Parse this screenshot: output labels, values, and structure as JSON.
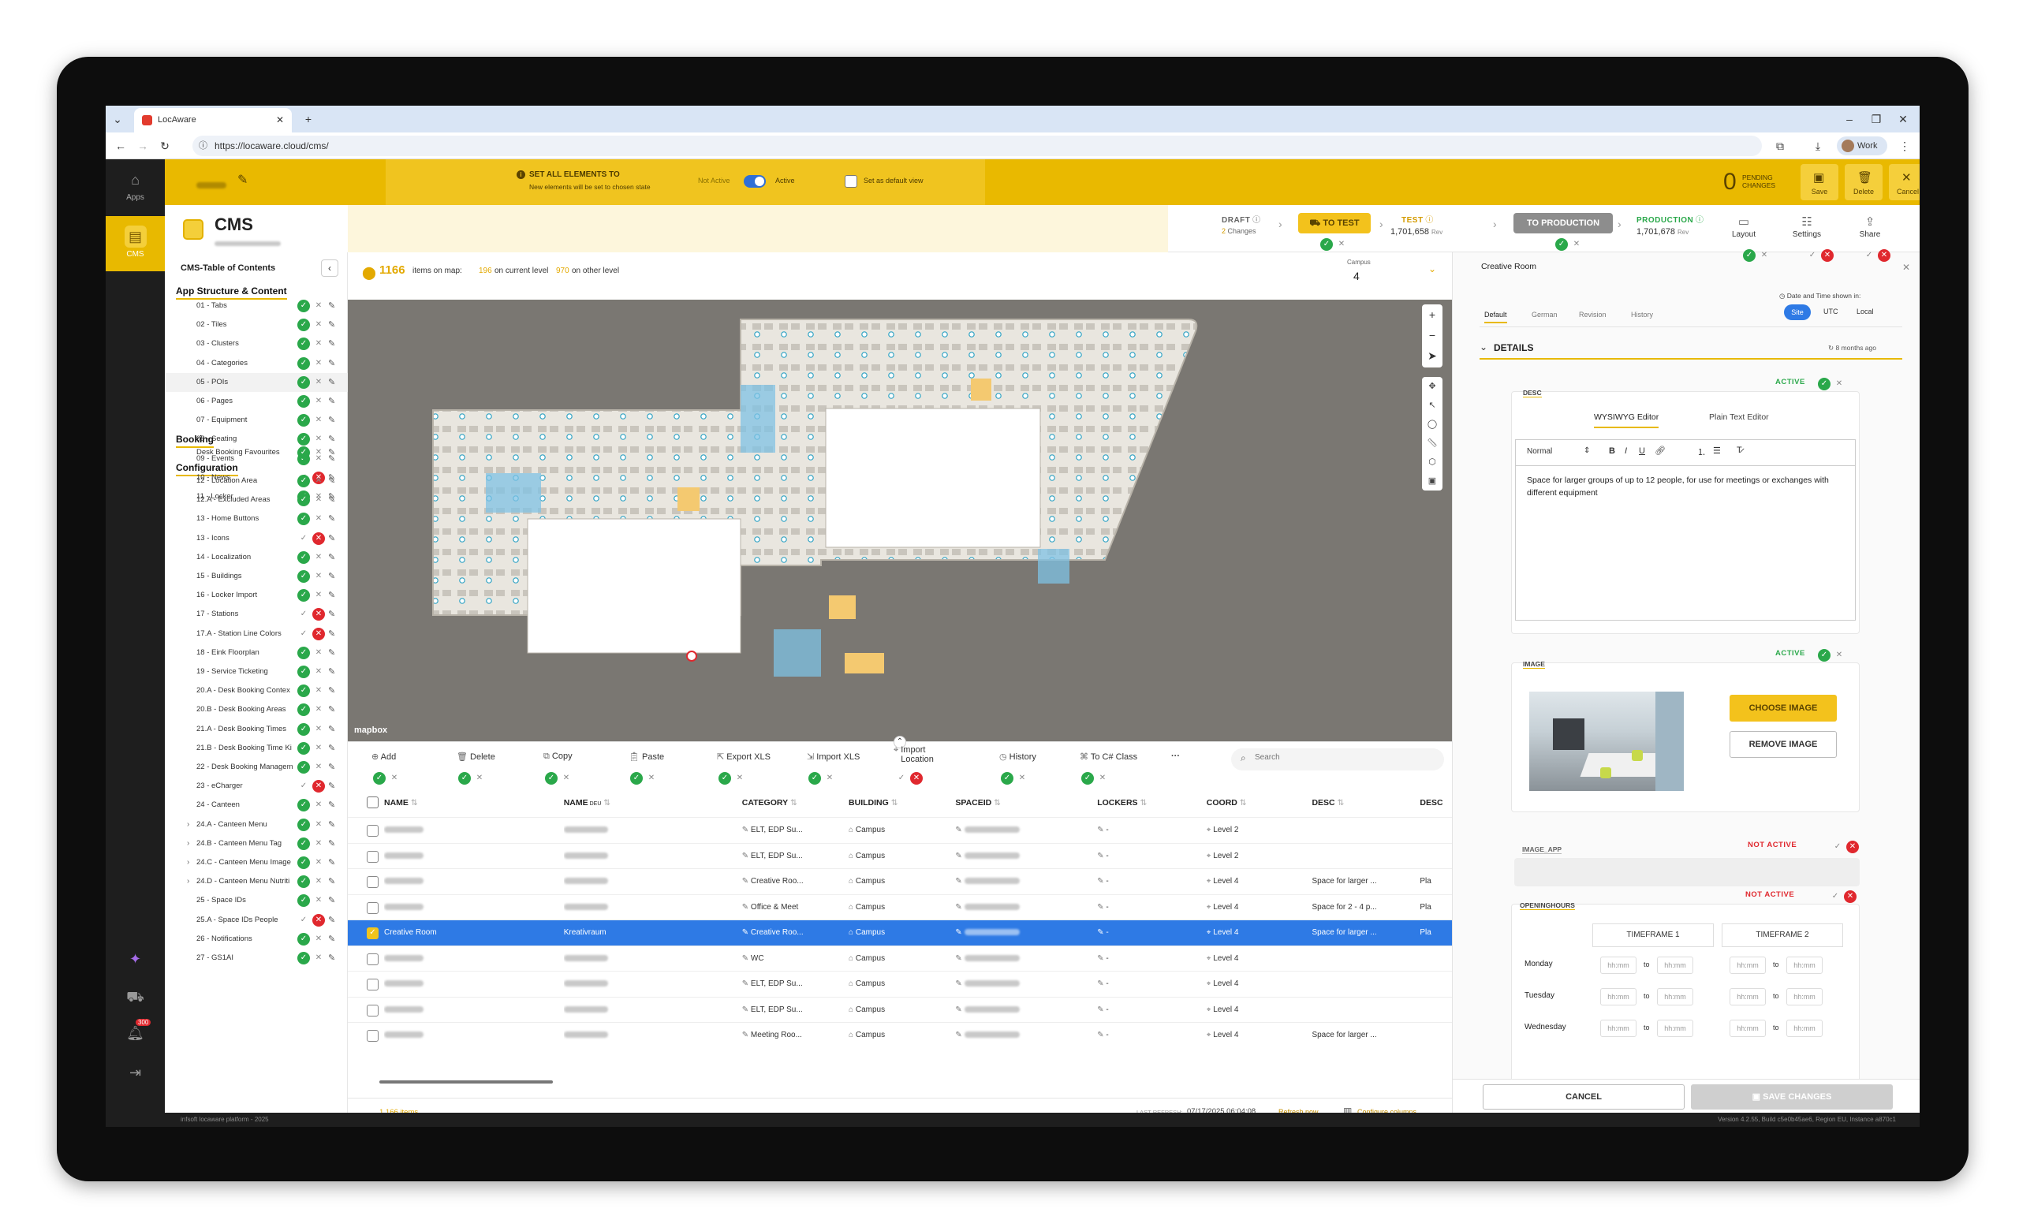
{
  "browser": {
    "tab_title": "LocAware",
    "url": "https://locaware.cloud/cms/",
    "profile": "Work"
  },
  "rail": {
    "apps_label": "Apps",
    "cms_label": "CMS",
    "notif_count": "300"
  },
  "topbar": {
    "set_all_title": "SET ALL ELEMENTS TO",
    "set_all_sub": "New elements will be set to chosen state",
    "not_active": "Not Active",
    "active": "Active",
    "default_view": "Set as default view",
    "pending_count": "0",
    "pending_label": "PENDING CHANGES",
    "save": "Save",
    "delete": "Delete",
    "cancel": "Cancel"
  },
  "subbar": {
    "title": "CMS",
    "draft_label": "DRAFT",
    "draft_changes": "2",
    "changes_word": "Changes",
    "to_test": "TO TEST",
    "test_label": "TEST",
    "test_rev": "1,701,658",
    "rev_word": "Rev",
    "to_production": "TO PRODUCTION",
    "production_label": "PRODUCTION",
    "production_rev": "1,701,678",
    "layout": "Layout",
    "settings": "Settings",
    "share": "Share"
  },
  "sidebar": {
    "title": "CMS-Table of Contents",
    "sections": [
      {
        "label": "App Structure & Content"
      },
      {
        "label": "Booking"
      },
      {
        "label": "Configuration"
      }
    ],
    "items": [
      {
        "label": "01 - Tabs",
        "state": "ok"
      },
      {
        "label": "02 - Tiles",
        "state": "ok"
      },
      {
        "label": "03 - Clusters",
        "state": "ok"
      },
      {
        "label": "04 - Categories",
        "state": "ok"
      },
      {
        "label": "05 - POIs",
        "state": "ok"
      },
      {
        "label": "06 - Pages",
        "state": "ok"
      },
      {
        "label": "07 - Equipment",
        "state": "ok"
      },
      {
        "label": "08 - Seating",
        "state": "ok"
      },
      {
        "label": "09 - Events",
        "state": "ok"
      },
      {
        "label": "10 - News",
        "state": "no"
      },
      {
        "label": "11 - Locker",
        "state": "ok"
      },
      {
        "label": "Desk Booking Favourites",
        "state": "ok"
      },
      {
        "label": "12 - Location Area",
        "state": "ok"
      },
      {
        "label": "12.A - Excluded Areas",
        "state": "ok"
      },
      {
        "label": "13 - Home Buttons",
        "state": "ok"
      },
      {
        "label": "13 - Icons",
        "state": "no"
      },
      {
        "label": "14 - Localization",
        "state": "ok"
      },
      {
        "label": "15 - Buildings",
        "state": "ok"
      },
      {
        "label": "16 - Locker Import",
        "state": "ok"
      },
      {
        "label": "17 - Stations",
        "state": "no"
      },
      {
        "label": "17.A - Station Line Colors",
        "state": "no"
      },
      {
        "label": "18 - Eink Floorplan",
        "state": "ok"
      },
      {
        "label": "19 - Service Ticketing",
        "state": "ok"
      },
      {
        "label": "20.A - Desk Booking Contex",
        "state": "ok"
      },
      {
        "label": "20.B - Desk Booking Areas",
        "state": "ok"
      },
      {
        "label": "21.A - Desk Booking Times",
        "state": "ok"
      },
      {
        "label": "21.B - Desk Booking Time Ki",
        "state": "ok"
      },
      {
        "label": "22 - Desk Booking Managem",
        "state": "ok"
      },
      {
        "label": "23 - eCharger",
        "state": "no"
      },
      {
        "label": "24 - Canteen",
        "state": "ok"
      },
      {
        "label": "24.A - Canteen Menu",
        "state": "ok"
      },
      {
        "label": "24.B - Canteen Menu Tag",
        "state": "ok"
      },
      {
        "label": "24.C - Canteen Menu Image",
        "state": "ok"
      },
      {
        "label": "24.D - Canteen Menu Nutriti",
        "state": "ok"
      },
      {
        "label": "25 - Space IDs",
        "state": "ok"
      },
      {
        "label": "25.A - Space IDs People",
        "state": "no"
      },
      {
        "label": "26 - Notifications",
        "state": "ok"
      },
      {
        "label": "27 - GS1AI",
        "state": "ok"
      }
    ],
    "footer": "infsoft locaware platform - 2025"
  },
  "map": {
    "items_count": "1166",
    "items_on_map": "items on map:",
    "current_count": "196",
    "current_label": "on current level",
    "other_count": "970",
    "other_label": "on other level",
    "campus_label": "Campus",
    "campus_value": "4",
    "attribution": "mapbox"
  },
  "toolbar": {
    "add": "Add",
    "delete": "Delete",
    "copy": "Copy",
    "paste": "Paste",
    "export_xls": "Export XLS",
    "import_xls": "Import XLS",
    "import_location": "Import Location",
    "history": "History",
    "to_csharp": "To C# Class",
    "more": "···",
    "search_placeholder": "Search"
  },
  "grid": {
    "headers": {
      "name": "NAME",
      "name_deu": "NAME",
      "deu_sub": "DEU",
      "category": "CATEGORY",
      "building": "BUILDING",
      "spaceid": "SPACEID",
      "lockers": "LOCKERS",
      "coord": "COORD",
      "desc": "DESC",
      "desc2": "DESC"
    },
    "rows": [
      {
        "name": "",
        "name_deu": "",
        "category": "ELT, EDP Su...",
        "building": "Campus",
        "lockers": "-",
        "coord": "Level 2",
        "desc": "",
        "desc2": "",
        "selected": false
      },
      {
        "name": "",
        "name_deu": "",
        "category": "ELT, EDP Su...",
        "building": "Campus",
        "lockers": "-",
        "coord": "Level 2",
        "desc": "",
        "desc2": "",
        "selected": false
      },
      {
        "name": "",
        "name_deu": "",
        "category": "Creative Roo...",
        "building": "Campus",
        "lockers": "-",
        "coord": "Level 4",
        "desc": "Space for larger ...",
        "desc2": "Pla",
        "selected": false
      },
      {
        "name": "",
        "name_deu": "",
        "category": "Office & Meet",
        "building": "Campus",
        "lockers": "-",
        "coord": "Level 4",
        "desc": "Space for 2 - 4 p...",
        "desc2": "Pla",
        "selected": false
      },
      {
        "name": "Creative Room",
        "name_deu": "Kreativraum",
        "category": "Creative Roo...",
        "building": "Campus",
        "lockers": "-",
        "coord": "Level 4",
        "desc": "Space for larger ...",
        "desc2": "Pla",
        "selected": true
      },
      {
        "name": "",
        "name_deu": "",
        "category": "WC",
        "building": "Campus",
        "lockers": "-",
        "coord": "Level 4",
        "desc": "",
        "desc2": "",
        "selected": false
      },
      {
        "name": "",
        "name_deu": "",
        "category": "ELT, EDP Su...",
        "building": "Campus",
        "lockers": "-",
        "coord": "Level 4",
        "desc": "",
        "desc2": "",
        "selected": false
      },
      {
        "name": "",
        "name_deu": "",
        "category": "ELT, EDP Su...",
        "building": "Campus",
        "lockers": "-",
        "coord": "Level 4",
        "desc": "",
        "desc2": "",
        "selected": false
      },
      {
        "name": "",
        "name_deu": "",
        "category": "Meeting Roo...",
        "building": "Campus",
        "lockers": "-",
        "coord": "Level 4",
        "desc": "Space for larger ...",
        "desc2": "",
        "selected": false
      }
    ],
    "total": "1,166 items",
    "last_refresh_label": "LAST REFRESH:",
    "last_refresh": "07/17/2025 06:04:08",
    "refresh_now": "Refresh now",
    "configure_columns": "Configure columns"
  },
  "panel": {
    "title": "Creative Room",
    "timezone_label": "Date and Time shown in:",
    "tz_site": "Site",
    "tz_utc": "UTC",
    "tz_local": "Local",
    "tabs": [
      "Default",
      "German",
      "Revision",
      "History"
    ],
    "details": "DETAILS",
    "updated": "8 months ago",
    "desc": {
      "label": "DESC",
      "state": "ACTIVE",
      "wysiwyg": "WYSIWYG Editor",
      "plain": "Plain Text Editor",
      "format": "Normal",
      "text": "Space for larger groups of up to 12 people, for use for meetings or exchanges with different equipment"
    },
    "image": {
      "label": "IMAGE",
      "state": "ACTIVE",
      "choose": "CHOOSE IMAGE",
      "remove": "REMOVE IMAGE"
    },
    "image_app": {
      "label": "IMAGE_APP",
      "state": "NOT ACTIVE"
    },
    "opening": {
      "label": "OPENINGHOURS",
      "state": "NOT ACTIVE",
      "tf1": "TIMEFRAME 1",
      "tf2": "TIMEFRAME 2",
      "days": [
        "Monday",
        "Tuesday",
        "Wednesday"
      ],
      "placeholder": "hh:mm",
      "to": "to"
    },
    "cancel": "CANCEL",
    "save": "SAVE CHANGES"
  },
  "version": "Version 4.2.55, Build c5e0b45ae6, Region EU, Instance a870c1",
  "colors": {
    "brand_yellow": "#e9b900",
    "accent_blue": "#2e7ae5",
    "active_green": "#2aa84a",
    "inactive_red": "#e0282e"
  }
}
